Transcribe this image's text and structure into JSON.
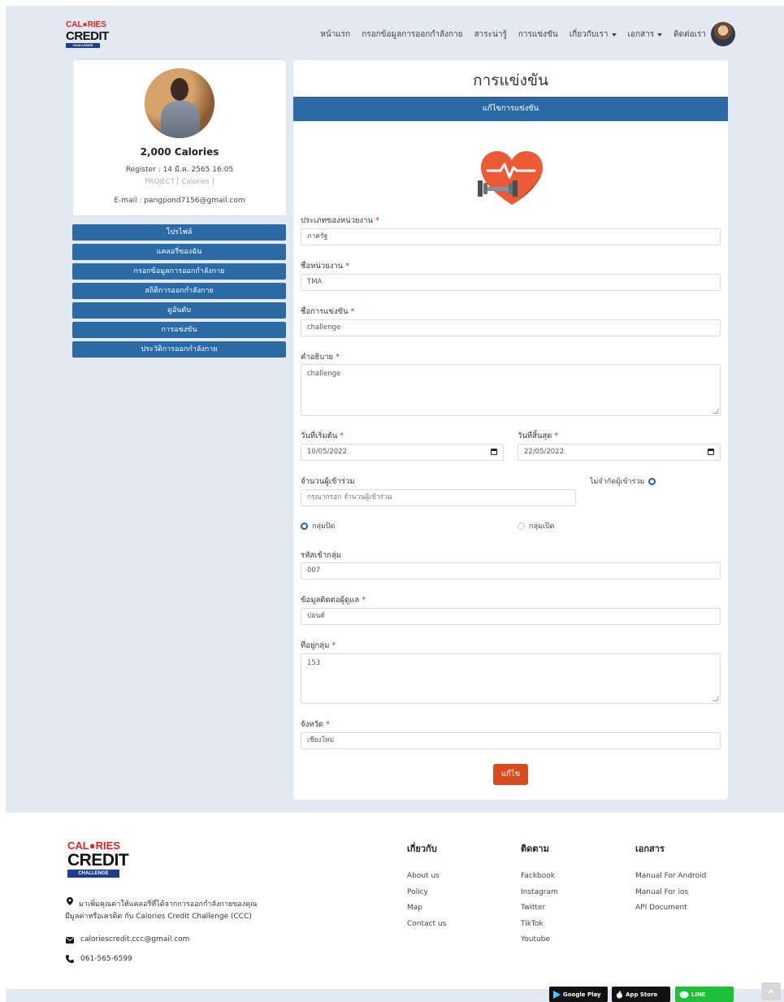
{
  "brand": {
    "logo_top": "CAL●RIES",
    "logo_main": "CREDIT",
    "logo_sub": "CHALLENGE"
  },
  "nav": {
    "items": [
      "หน้าแรก",
      "กรอกข้อมูลการออกกำลังกาย",
      "สาระน่ารู้",
      "การแข่งขัน",
      "เกี่ยวกับเรา",
      "เอกสาร",
      "ติดต่อเรา"
    ]
  },
  "profile": {
    "calories": "2,000 Calories",
    "register": "Register : 14 มี.ค. 2565 16:05",
    "project": "PROJECT [ Calories ]",
    "email": "E-mail : pangpond7156@gmail.com"
  },
  "sidebar": {
    "items": [
      "โปรไฟล์",
      "แคลอรี่ของฉัน",
      "กรอกข้อมูลการออกกำลังกาย",
      "สถิติการออกกำลังกาย",
      "ดูอันดับ",
      "การแข่งขัน",
      "ประวัติการออกกำลังกาย"
    ]
  },
  "form": {
    "title": "การแข่งขัน",
    "subtitle": "แก้ไขการแข่งขัน",
    "required_mark": "*",
    "agency_type": {
      "label": "ประเภทของหน่วยงาน",
      "value": "ภาครัฐ"
    },
    "agency_name": {
      "label": "ชื่อหน่วยงาน",
      "value": "TMA"
    },
    "competition_name": {
      "label": "ชื่อการแข่งขัน",
      "value": "challenge"
    },
    "description": {
      "label": "คำอธิบาย",
      "value": "challenge"
    },
    "start_date": {
      "label": "วันที่เริ่มต้น",
      "value": "10/05/2022"
    },
    "end_date": {
      "label": "วันที่สิ้นสุด",
      "value": "22/05/2022"
    },
    "participants": {
      "label": "จำนวนผู้เข้าร่วม",
      "placeholder": "กรุณากรอก จำนวนผู้เข้าร่วม"
    },
    "unlimited_label": "ไม่จำกัดผู้เข้าร่วม",
    "group_closed": "กลุ่มปิด",
    "group_open": "กลุ่มเปิด",
    "group_code": {
      "label": "รหัสเข้ากลุ่ม",
      "value": "007"
    },
    "admin_contact": {
      "label": "ข้อมูลติดต่อผู้ดูแล",
      "value": "ปอนด์"
    },
    "group_address": {
      "label": "ที่อยู่กลุ่ม",
      "value": "153"
    },
    "province": {
      "label": "จังหวัด",
      "value": "เชียงใหม่"
    },
    "submit_label": "แก้ไข"
  },
  "footer": {
    "tagline_1": "มาเพิ่มคุณค่าให้แคลอรี่ที่ได้จากการออกกำลังกายของคุณ",
    "tagline_2": "มีมูลค่าหรือเครดิต กับ Calories Credit Challenge (CCC)",
    "email": "caloriescredit.ccc@gmail.com",
    "phone": "061-565-6599",
    "about": {
      "title": "เกี่ยวกับ",
      "links": [
        "About us",
        "Policy",
        "Map",
        "Contact us"
      ]
    },
    "follow": {
      "title": "ติดตาม",
      "links": [
        "Fackbook",
        "Instagram",
        "Twitter",
        "TikTok",
        "Youtube"
      ]
    },
    "docs": {
      "title": "เอกสาร",
      "links": [
        "Manual For Android",
        "Manual For ios",
        "API Document"
      ]
    },
    "badges": {
      "google": "Google Play",
      "apple": "App Store",
      "line": "LINE"
    }
  }
}
